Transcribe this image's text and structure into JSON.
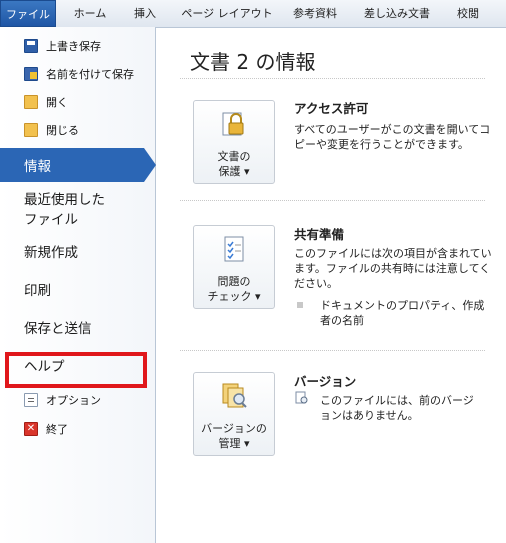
{
  "ribbon": {
    "tabs": [
      "ファイル",
      "ホーム",
      "挿入",
      "ページ レイアウト",
      "参考資料",
      "差し込み文書",
      "校閲"
    ]
  },
  "sidebar": {
    "commands": {
      "save": "上書き保存",
      "save_as": "名前を付けて保存",
      "open": "開く",
      "close": "閉じる"
    },
    "nav": {
      "info": "情報",
      "recent_1": "最近使用した",
      "recent_2": "ファイル",
      "new": "新規作成",
      "print": "印刷",
      "save_send": "保存と送信",
      "help": "ヘルプ"
    },
    "options": "オプション",
    "exit": "終了"
  },
  "main": {
    "title": "文書 2 の情報",
    "permissions": {
      "button_1": "文書の",
      "button_2": "保護 ▾",
      "heading": "アクセス許可",
      "text": "すべてのユーザーがこの文書を開いてコピーや変更を行うことができます。"
    },
    "prepare": {
      "button_1": "問題の",
      "button_2": "チェック ▾",
      "heading": "共有準備",
      "text": "このファイルには次の項目が含まれています。ファイルの共有時には注意してください。",
      "item": "ドキュメントのプロパティ、作成者の名前"
    },
    "versions": {
      "button_1": "バージョンの",
      "button_2": "管理 ▾",
      "heading": "バージョン",
      "text": "このファイルには、前のバージョンはありません。"
    }
  },
  "colors": {
    "accent": "#2b66b5",
    "highlight": "#e0171b",
    "file_tab": "#2a62b0"
  }
}
